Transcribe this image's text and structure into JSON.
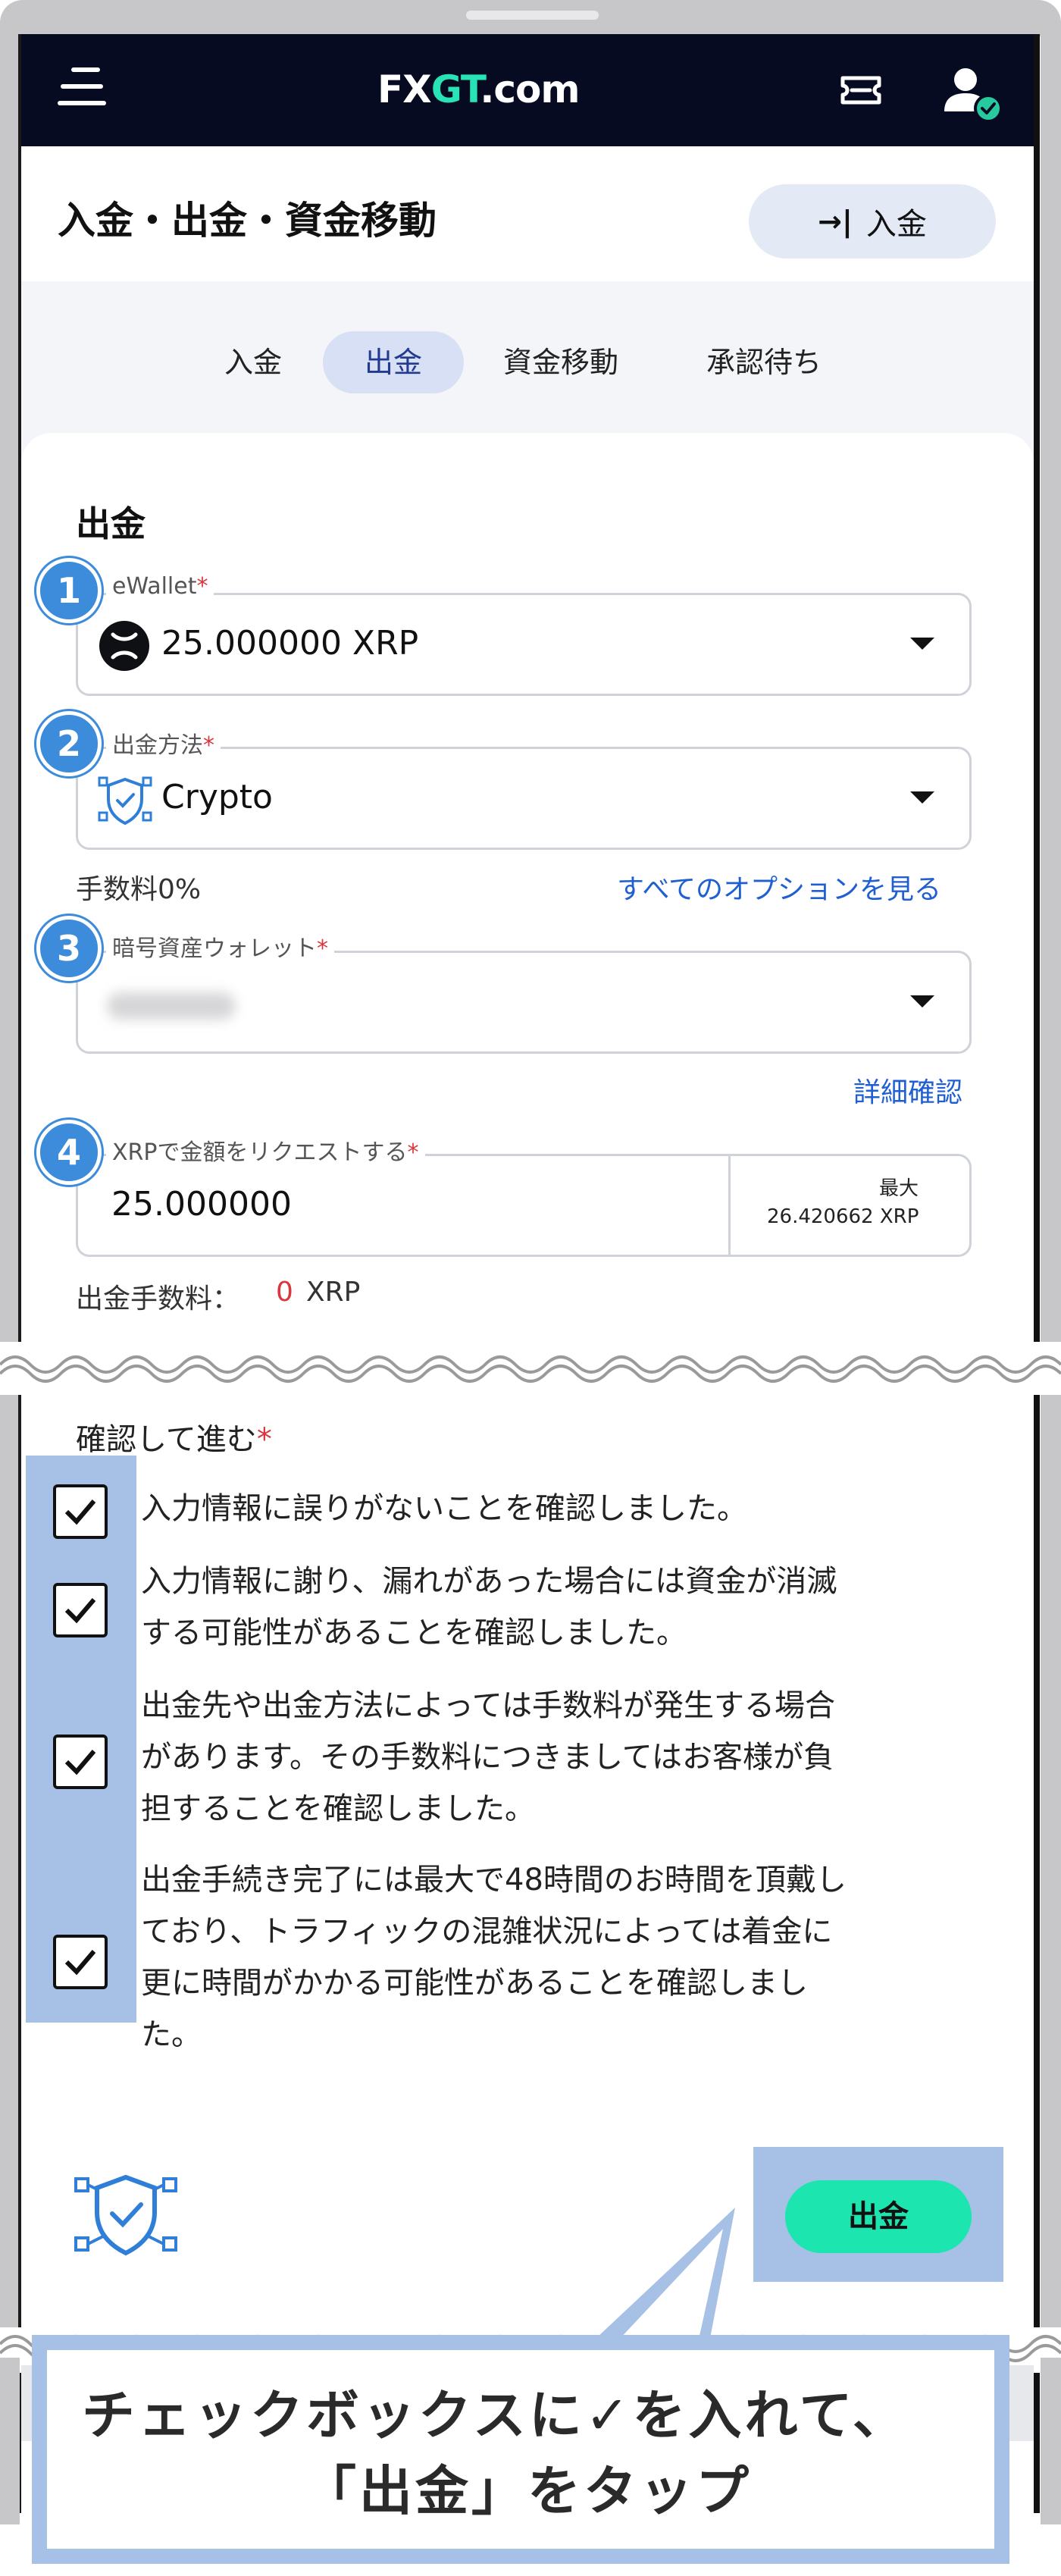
{
  "header": {
    "logo_fx": "FX",
    "logo_gt": "GT",
    "logo_com": ".com",
    "menu_icon": "hamburger-menu-icon",
    "ticket_icon": "ticket-icon",
    "user_icon": "user-verified-icon"
  },
  "page": {
    "title": "入金・出金・資金移動",
    "deposit_button": "入金"
  },
  "tabs": [
    {
      "label": "入金",
      "active": false
    },
    {
      "label": "出金",
      "active": true
    },
    {
      "label": "資金移動",
      "active": false
    },
    {
      "label": "承認待ち",
      "active": false
    }
  ],
  "form": {
    "section_title": "出金",
    "ewallet": {
      "step": "1",
      "label": "eWallet",
      "required": "*",
      "value": "25.000000 XRP",
      "icon": "xrp-icon"
    },
    "method": {
      "step": "2",
      "label": "出金方法",
      "required": "*",
      "value": "Crypto",
      "icon": "crypto-shield-icon"
    },
    "fee_text": "手数料0%",
    "all_options_link": "すべてのオプションを見る",
    "wallet": {
      "step": "3",
      "label": "暗号資産ウォレット",
      "required": "*"
    },
    "details_link": "詳細確認",
    "amount": {
      "step": "4",
      "label": "XRPで金額をリクエストする",
      "required": "*",
      "value": "25.000000",
      "max_label": "最大",
      "max_value": "26.420662 XRP"
    },
    "withdraw_fee_label": "出金手数料：",
    "withdraw_fee_amount": "0",
    "withdraw_fee_unit": "XRP"
  },
  "confirm": {
    "title": "確認して進む",
    "required": "*",
    "items": [
      {
        "checked": true,
        "lines": [
          "入力情報に誤りがないことを確認しました。"
        ]
      },
      {
        "checked": true,
        "lines": [
          "入力情報に謝り、漏れがあった場合には資金が消滅",
          "する可能性があることを確認しました。"
        ]
      },
      {
        "checked": true,
        "lines": [
          "出金先や出金方法によっては手数料が発生する場合",
          "があります。その手数料につきましてはお客様が負",
          "担することを確認しました。"
        ]
      },
      {
        "checked": true,
        "lines": [
          "出金手続き完了には最大で48時間のお時間を頂戴し",
          "ており、トラフィックの混雑状況によっては着金に",
          "更に時間がかかる可能性があることを確認しまし",
          "た。"
        ]
      }
    ],
    "submit_button": "出金"
  },
  "callout": {
    "line1": "チェックボックスに✓を入れて、",
    "line2": "「出金」をタップ"
  },
  "colors": {
    "header_bg": "#070b22",
    "logo_accent": "#27e3b5",
    "step_badge": "#3d8bdb",
    "link": "#1f5fd1",
    "required": "#d9363e",
    "submit_bg": "#1de5b0",
    "highlight": "#a6c0e6"
  }
}
